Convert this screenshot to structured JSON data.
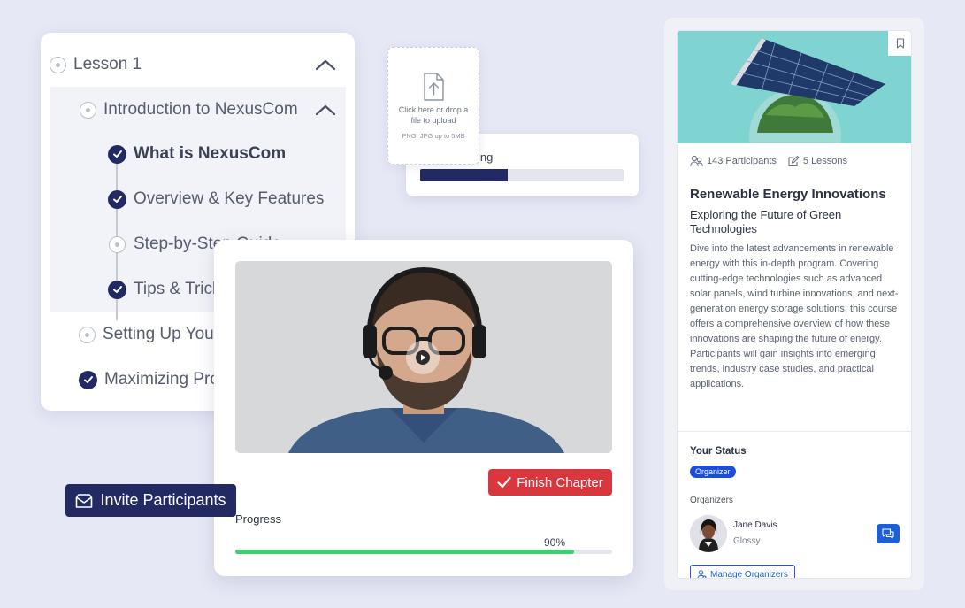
{
  "lessons": {
    "lesson_title": "Lesson 1",
    "section_title": "Introduction to NexusCom",
    "items": [
      {
        "label": "What is NexusCom",
        "done": true
      },
      {
        "label": "Overview & Key Features",
        "done": true
      },
      {
        "label": "Step-by-Step Guide",
        "done": false
      },
      {
        "label": "Tips & Tricks",
        "done": true
      }
    ],
    "more_sections": [
      {
        "label": "Setting Up Your",
        "done": false
      },
      {
        "label": "Maximizing Pro",
        "done": true
      }
    ]
  },
  "upload": {
    "text": "Click here or drop a file to upload",
    "hint": "PNG, JPG up to 5MB"
  },
  "onboarding": {
    "label": "th Onboarding",
    "progress": 0.43
  },
  "video_card": {
    "finish_label": "Finish Chapter",
    "progress_label": "Progress",
    "progress_pct_text": "90%",
    "progress": 0.9
  },
  "invite": {
    "label": "Invite Participants"
  },
  "course": {
    "participants": "143 Participants",
    "lessons": "5 Lessons",
    "title": "Renewable Energy Innovations",
    "subtitle": "Exploring the Future of Green Technologies",
    "description": "Dive into the latest advancements in renewable energy with this in-depth program. Covering cutting-edge technologies such as advanced solar panels, wind turbine innovations, and next-generation energy storage solutions, this course offers a comprehensive overview of how these innovations are shaping the future of energy. Participants will gain insights into emerging trends, industry case studies, and practical applications.",
    "status_label": "Your Status",
    "status_badge": "Organizer",
    "organizers_label": "Organizers",
    "organizer_name": "Jane Davis",
    "organizer_role": "Glossy",
    "manage_label": "Manage Organizers"
  },
  "colors": {
    "navy": "#232a63",
    "finish_red": "#d9363e",
    "progress_green": "#3ecf6e",
    "link_blue": "#1d5fd6"
  },
  "icons": [
    "chevron-up-icon",
    "check-circle-icon",
    "upload-file-icon",
    "play-icon",
    "check-icon",
    "mail-icon",
    "bookmark-icon",
    "participants-icon",
    "lessons-icon",
    "chat-icon",
    "manage-user-icon"
  ]
}
